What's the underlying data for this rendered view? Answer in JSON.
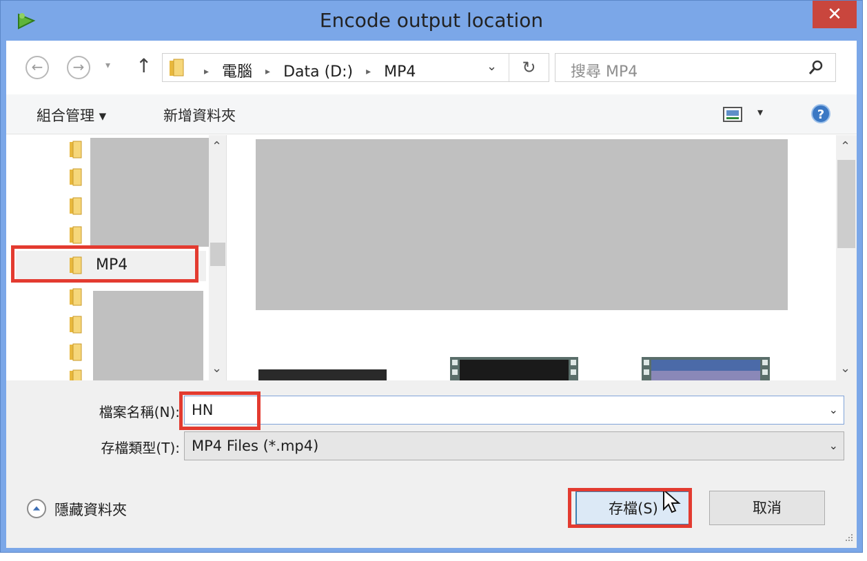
{
  "window": {
    "title": "Encode output location",
    "close_glyph": "✕"
  },
  "nav": {
    "back_glyph": "←",
    "forward_glyph": "→",
    "recent_glyph": "▾",
    "up_glyph": "↑"
  },
  "address": {
    "crumbs": [
      "電腦",
      "Data (D:)",
      "MP4"
    ],
    "sep_glyph": "▸",
    "drop_glyph": "⌄",
    "refresh_glyph": "↻"
  },
  "search": {
    "placeholder": "搜尋 MP4"
  },
  "toolbar": {
    "organize": "組合管理 ▾",
    "new_folder": "新增資料夾",
    "view_drop_glyph": "▾",
    "help_glyph": "?"
  },
  "tree": {
    "selected_label": "MP4",
    "scroll_up_glyph": "⌃",
    "scroll_down_glyph": "⌄"
  },
  "files": {
    "scroll_up_glyph": "⌃",
    "scroll_down_glyph": "⌄"
  },
  "form": {
    "filename_label": "檔案名稱(N):",
    "filename_value": "HN",
    "filetype_label": "存檔類型(T):",
    "filetype_value": "MP4 Files (*.mp4)",
    "drop_glyph": "⌄"
  },
  "footer": {
    "hide_folders": "隱藏資料夾",
    "save_button": "存檔(S)",
    "cancel_button": "取消"
  },
  "colors": {
    "titlebar": "#7ba7e8",
    "close": "#c9463d",
    "highlight": "#e33b30",
    "redaction": "#c0c0c0"
  },
  "icons": [
    "app-icon",
    "folder-icon",
    "search-icon",
    "view-icon",
    "help-icon",
    "cursor-icon",
    "grip-icon"
  ]
}
